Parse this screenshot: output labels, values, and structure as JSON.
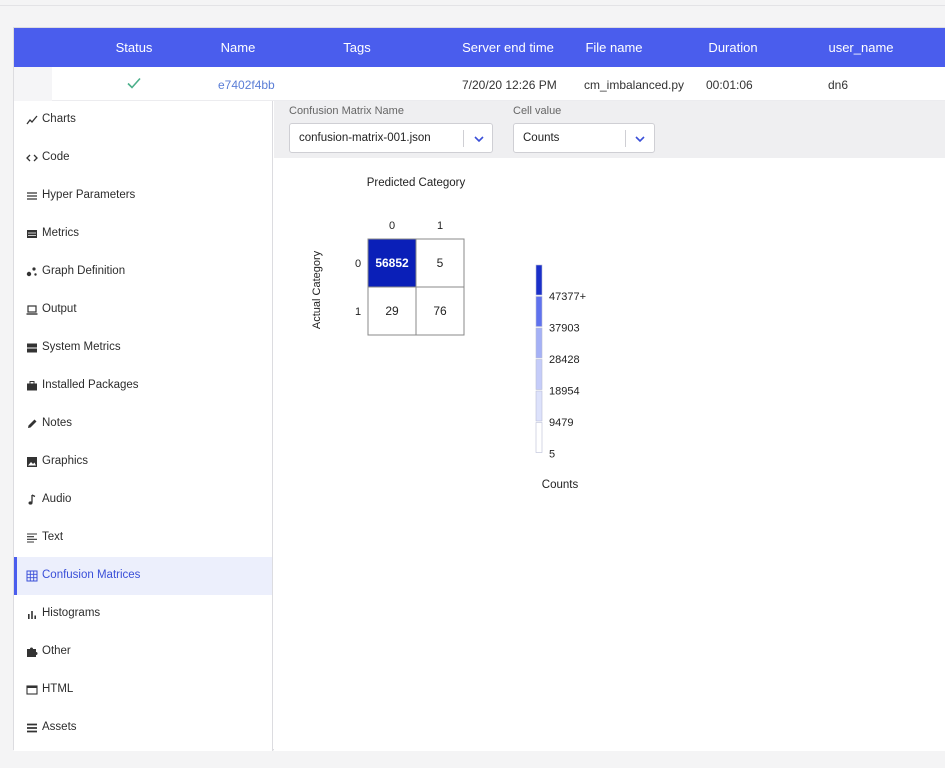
{
  "table": {
    "headers": [
      "Status",
      "Name",
      "Tags",
      "Server end time",
      "File name",
      "Duration",
      "user_name"
    ],
    "row": {
      "name": "e7402f4bb",
      "tags": "",
      "server_end_time": "7/20/20 12:26 PM",
      "file_name": "cm_imbalanced.py",
      "duration": "00:01:06",
      "user_name": "dn6"
    }
  },
  "sidebar": {
    "items": [
      {
        "label": "Charts",
        "icon": "line-chart-icon"
      },
      {
        "label": "Code",
        "icon": "code-icon"
      },
      {
        "label": "Hyper Parameters",
        "icon": "list-icon"
      },
      {
        "label": "Metrics",
        "icon": "metrics-icon"
      },
      {
        "label": "Graph Definition",
        "icon": "graph-icon"
      },
      {
        "label": "Output",
        "icon": "laptop-icon"
      },
      {
        "label": "System Metrics",
        "icon": "server-icon"
      },
      {
        "label": "Installed Packages",
        "icon": "briefcase-icon"
      },
      {
        "label": "Notes",
        "icon": "pencil-icon"
      },
      {
        "label": "Graphics",
        "icon": "image-icon"
      },
      {
        "label": "Audio",
        "icon": "music-note-icon"
      },
      {
        "label": "Text",
        "icon": "text-icon"
      },
      {
        "label": "Confusion Matrices",
        "icon": "grid-icon",
        "active": true
      },
      {
        "label": "Histograms",
        "icon": "bar-chart-icon"
      },
      {
        "label": "Other",
        "icon": "puzzle-icon"
      },
      {
        "label": "HTML",
        "icon": "html-icon"
      },
      {
        "label": "Assets",
        "icon": "assets-icon"
      }
    ]
  },
  "filters": {
    "cm_name_label": "Confusion Matrix Name",
    "cm_name_value": "confusion-matrix-001.json",
    "cell_value_label": "Cell value",
    "cell_value_value": "Counts"
  },
  "colors": {
    "accent": "#4a5ded",
    "cell_max": "#0a1fb8",
    "check": "#4caf8a",
    "link": "#5b7ed6"
  },
  "chart_data": {
    "type": "heatmap",
    "title": "Predicted Category",
    "xlabel": "Predicted Category",
    "ylabel": "Actual Category",
    "x_categories": [
      "0",
      "1"
    ],
    "y_categories": [
      "0",
      "1"
    ],
    "values": [
      [
        56852,
        5
      ],
      [
        29,
        76
      ]
    ],
    "colorbar": {
      "title": "Counts",
      "ticks": [
        "47377+",
        "37903",
        "28428",
        "18954",
        "9479",
        "5"
      ],
      "colors": [
        "#1a2fc9",
        "#5f72ee",
        "#a5b1f6",
        "#c5ccf9",
        "#dde2fb",
        "#ffffff"
      ]
    }
  }
}
